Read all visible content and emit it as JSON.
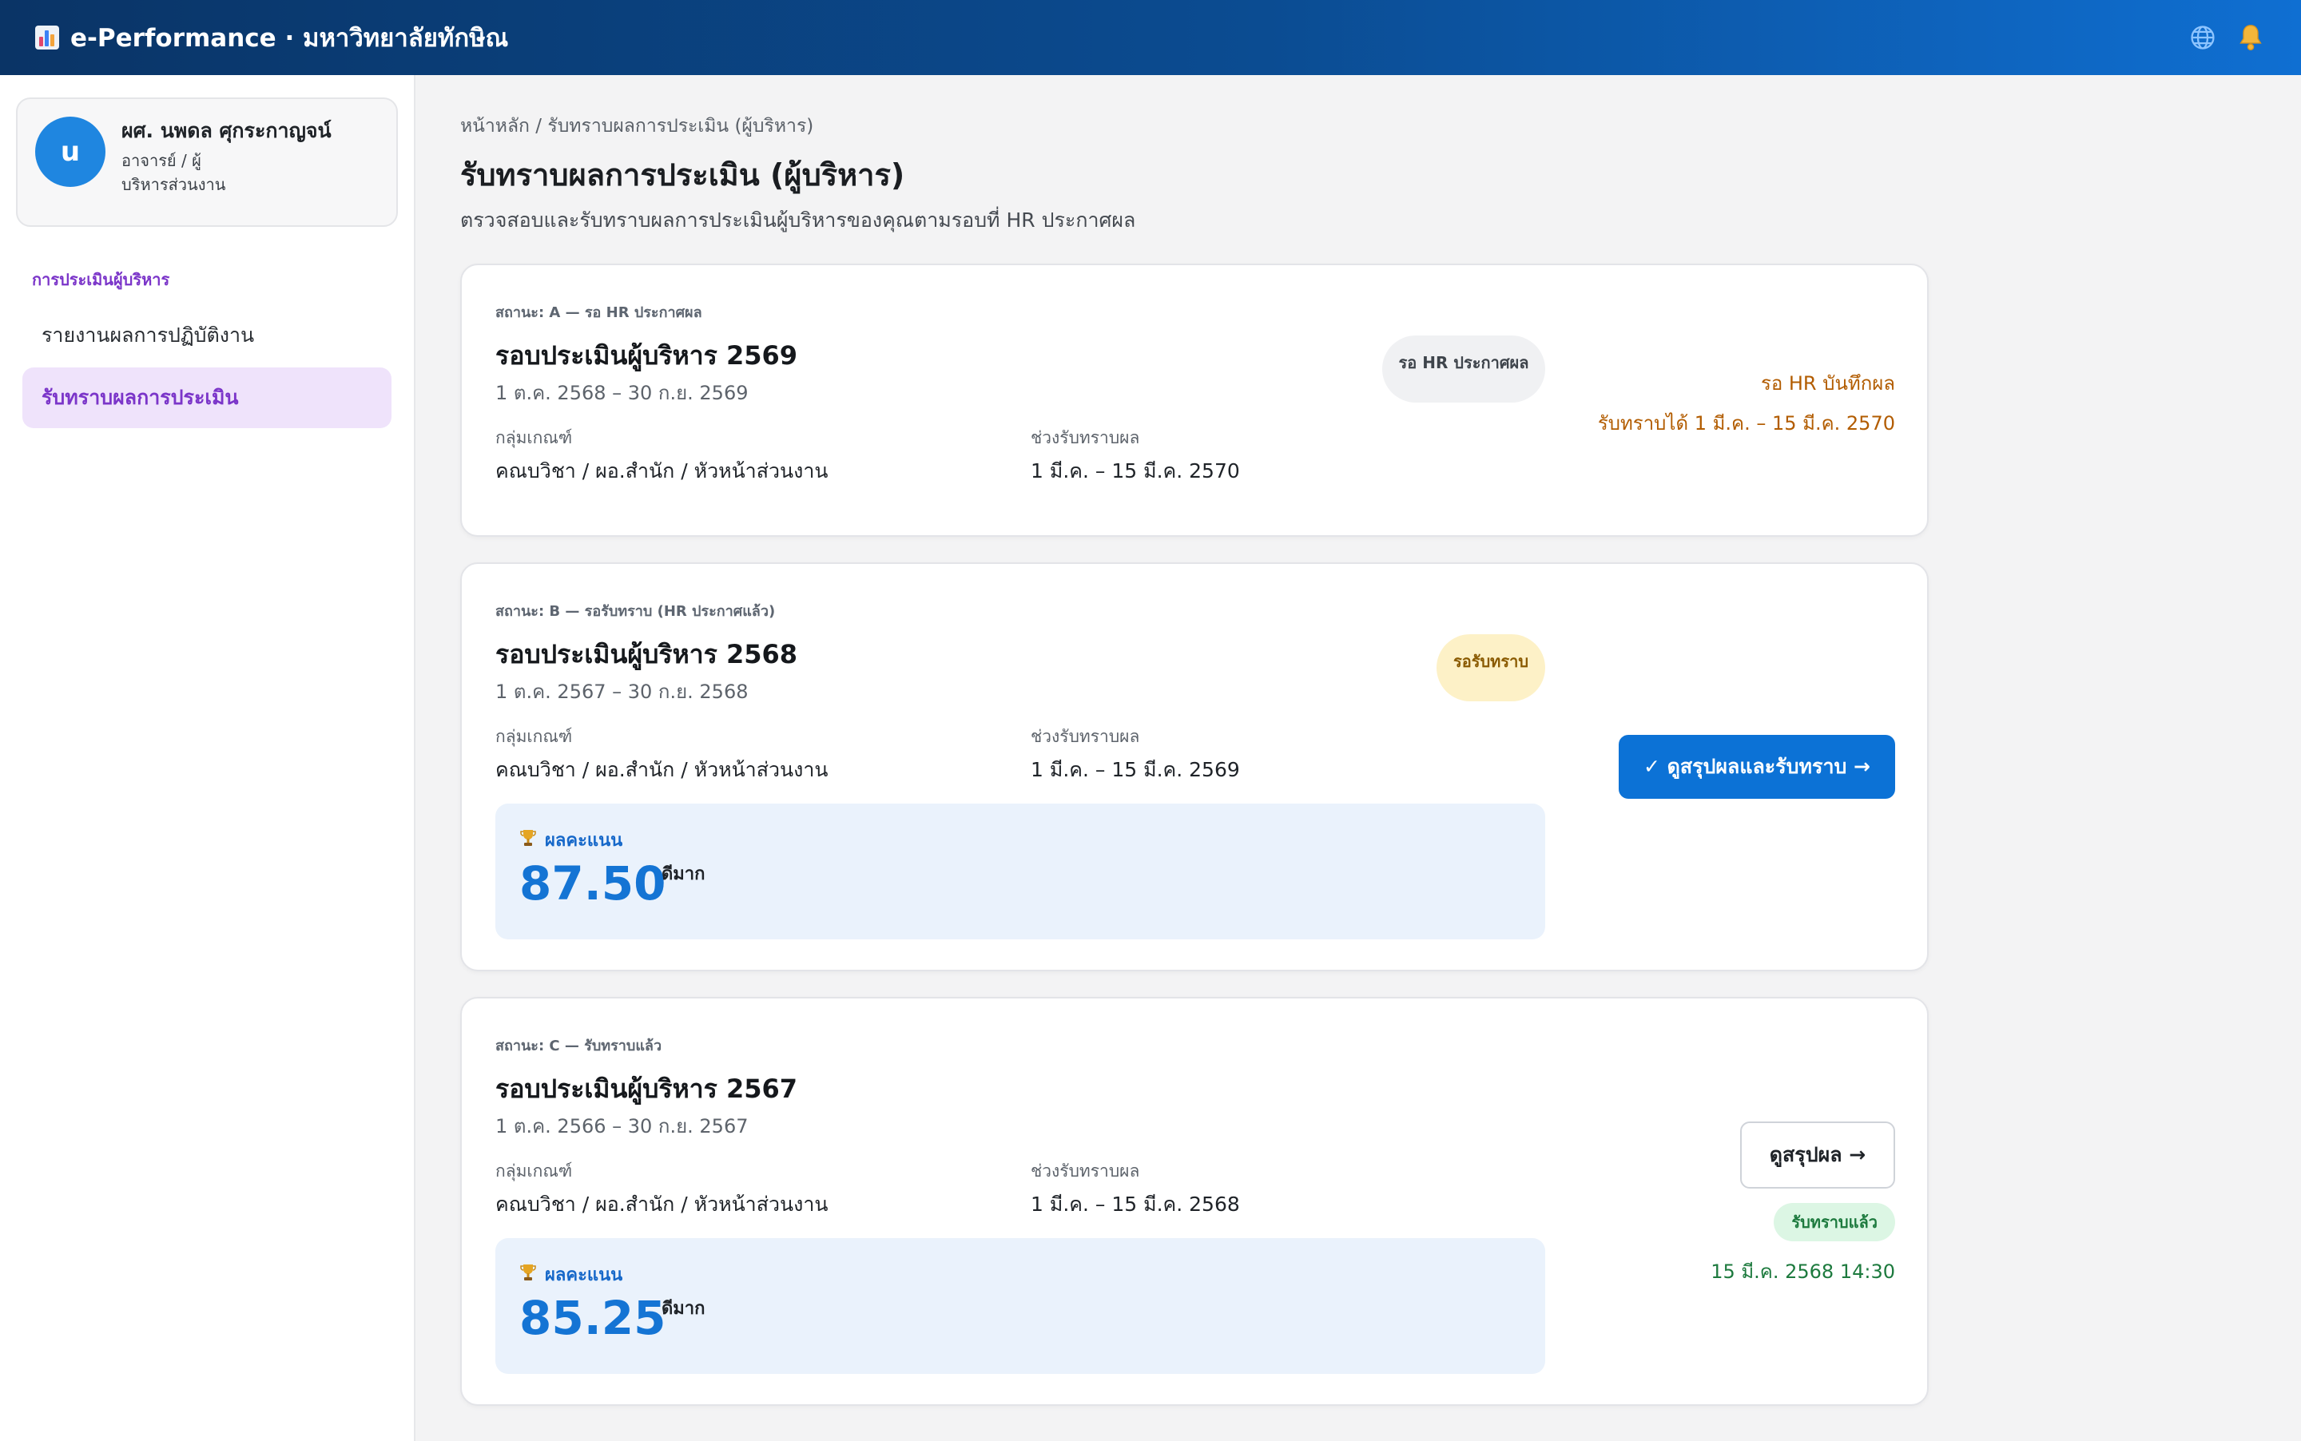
{
  "app": {
    "title": "e-Performance · มหาวิทยาลัยทักษิณ",
    "icons": {
      "logo": "bar-chart-icon",
      "language": "globe-icon",
      "notifications": "bell-icon"
    }
  },
  "user": {
    "initial": "u",
    "name": "ผศ. นพดล ศุกระกาญจน์",
    "role": "อาจารย์ / ผู้บริหารส่วนงาน"
  },
  "sidebar": {
    "section": "การประเมินผู้บริหาร",
    "items": [
      {
        "label": "รายงานผลการปฏิบัติงาน",
        "active": false
      },
      {
        "label": "รับทราบผลการประเมิน",
        "active": true
      }
    ]
  },
  "page": {
    "breadcrumb": "หน้าหลัก / รับทราบผลการประเมิน (ผู้บริหาร)",
    "title": "รับทราบผลการประเมิน (ผู้บริหาร)",
    "subtitle": "ตรวจสอบและรับทราบผลการประเมินผู้บริหารของคุณตามรอบที่ HR ประกาศผล"
  },
  "labels": {
    "group": "กลุ่มเกณฑ์",
    "window": "ช่วงรับทราบผล",
    "score": "ผลคะแนน"
  },
  "cards": [
    {
      "status": "สถานะ: A — รอ HR ประกาศผล",
      "title": "รอบประเมินผู้บริหาร 2569",
      "dates": "1 ต.ค. 2568 – 30 ก.ย. 2569",
      "group": "คณบวิชา / ผอ.สำนัก / หัวหน้าส่วนงาน",
      "window": "1 มี.ค. – 15 มี.ค. 2570",
      "badge": "รอ HR ประกาศผล",
      "note1": "รอ HR บันทึกผล",
      "note2": "รับทราบได้ 1 มี.ค. – 15 มี.ค. 2570"
    },
    {
      "status": "สถานะ: B — รอรับทราบ (HR ประกาศแล้ว)",
      "title": "รอบประเมินผู้บริหาร 2568",
      "dates": "1 ต.ค. 2567 – 30 ก.ย. 2568",
      "group": "คณบวิชา / ผอ.สำนัก / หัวหน้าส่วนงาน",
      "window": "1 มี.ค. – 15 มี.ค. 2569",
      "badge": "รอรับทราบ",
      "score": "87.50",
      "grade": "ดีมาก",
      "action": "✓ ดูสรุปผลและรับทราบ →"
    },
    {
      "status": "สถานะ: C — รับทราบแล้ว",
      "title": "รอบประเมินผู้บริหาร 2567",
      "dates": "1 ต.ค. 2566 – 30 ก.ย. 2567",
      "group": "คณบวิชา / ผอ.สำนัก / หัวหน้าส่วนงาน",
      "window": "1 มี.ค. – 15 มี.ค. 2568",
      "score": "85.25",
      "grade": "ดีมาก",
      "action": "ดูสรุปผล →",
      "ack_badge": "รับทราบแล้ว",
      "ack_time": "15 มี.ค. 2568 14:30"
    }
  ],
  "colors": {
    "topbar_start": "#0a3466",
    "topbar_end": "#0f6fd2",
    "accent_purple": "#7b35c9",
    "primary_blue": "#0c72d6",
    "warning": "#b25c00",
    "success": "#1d7a3e"
  }
}
